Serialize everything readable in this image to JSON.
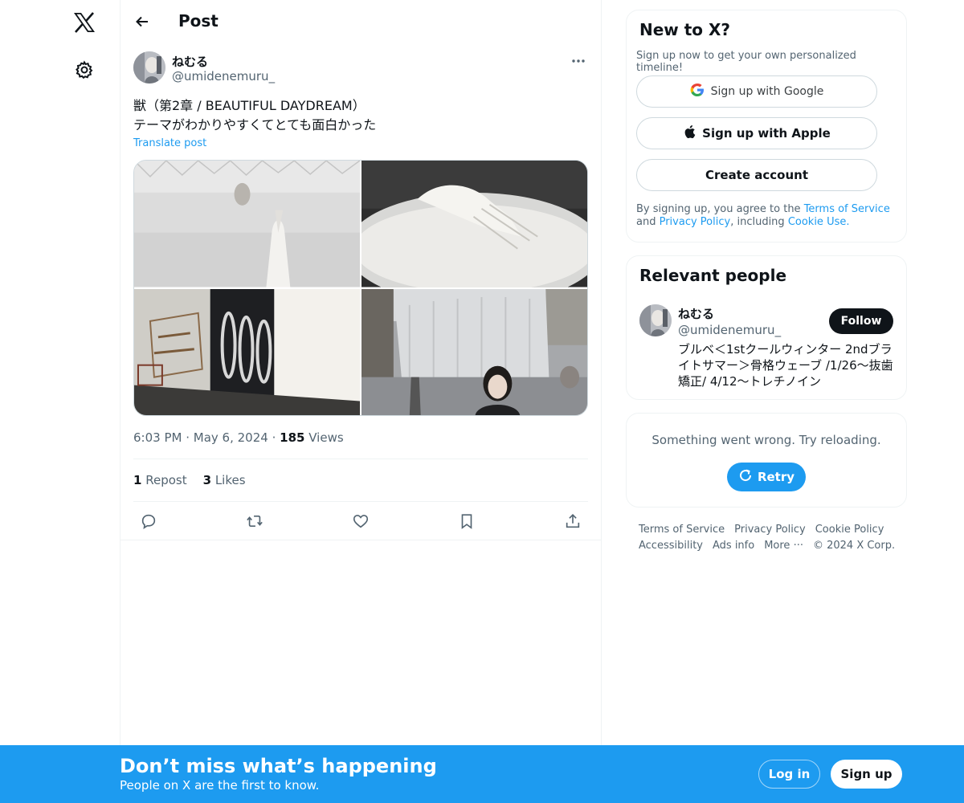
{
  "nav": {
    "logo_icon": "x-logo-icon",
    "settings_icon": "gear-icon"
  },
  "header": {
    "title": "Post"
  },
  "post": {
    "author_name": "ねむる",
    "author_handle": "@umidenemuru_",
    "text": "獣（第2章 / BEAUTIFUL DAYDREAM）\nテーマがわかりやすくてとても面白かった",
    "translate_label": "Translate post",
    "time": "6:03 PM",
    "date": "May 6, 2024",
    "views_count": "185",
    "views_label": "Views",
    "reposts_count": "1",
    "reposts_label": "Repost",
    "likes_count": "3",
    "likes_label": "Likes"
  },
  "sidebar": {
    "new_to_x": {
      "title": "New to X?",
      "subtitle": "Sign up now to get your own personalized timeline!",
      "google_label": "Sign up with Google",
      "apple_label": "Sign up with Apple",
      "create_label": "Create account",
      "legal_prefix": "By signing up, you agree to the ",
      "terms_link": "Terms of Service",
      "legal_and": " and ",
      "privacy_link": "Privacy Policy",
      "legal_including": ", including ",
      "cookie_link": "Cookie Use."
    },
    "relevant_people": {
      "title": "Relevant people",
      "name": "ねむる",
      "handle": "@umidenemuru_",
      "bio": "ブルベ＜1stクールウィンター 2ndブライトサマー＞骨格ウェーブ /1/26〜抜歯矯正/ 4/12〜トレチノイン",
      "follow_label": "Follow"
    },
    "error": {
      "message": "Something went wrong. Try reloading.",
      "retry_label": "Retry"
    },
    "footer": {
      "terms": "Terms of Service",
      "privacy": "Privacy Policy",
      "cookie": "Cookie Policy",
      "accessibility": "Accessibility",
      "ads": "Ads info",
      "more": "More ···",
      "copyright": "© 2024 X Corp."
    }
  },
  "banner": {
    "title": "Don’t miss what’s happening",
    "subtitle": "People on X are the first to know.",
    "login_label": "Log in",
    "signup_label": "Sign up"
  },
  "colors": {
    "accent": "#1d9bf0",
    "text": "#0f1419",
    "muted": "#536471",
    "border": "#eff3f4"
  }
}
